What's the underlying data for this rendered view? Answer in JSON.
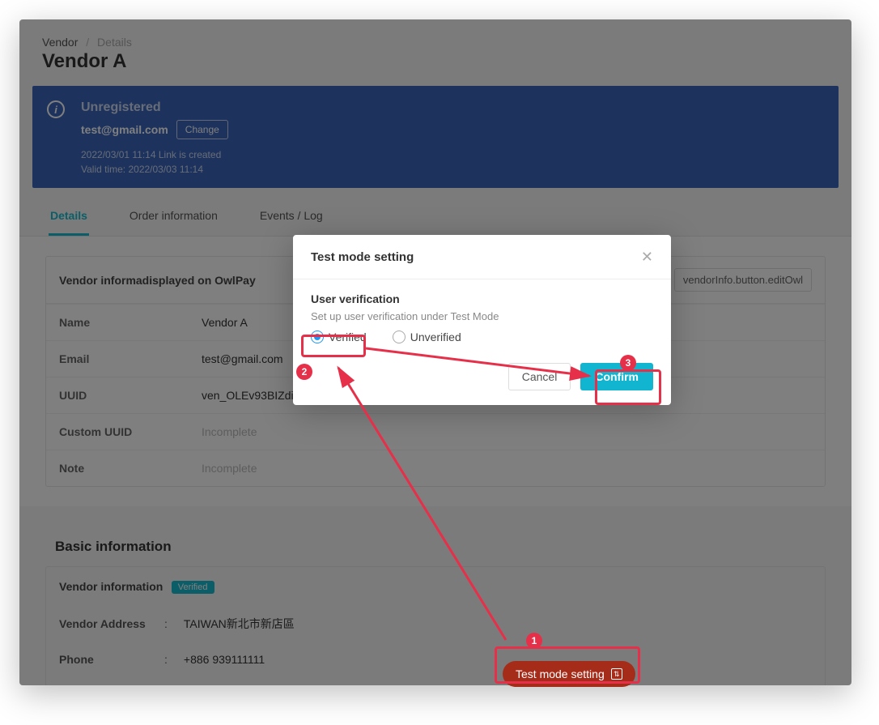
{
  "crumbs": {
    "root": "Vendor",
    "current": "Details"
  },
  "page_title": "Vendor A",
  "banner": {
    "status": "Unregistered",
    "email": "test@gmail.com",
    "change_label": "Change",
    "meta1": "2022/03/01 11:14 Link is created",
    "meta2": "Valid time: 2022/03/03 11:14"
  },
  "tabs": {
    "details": "Details",
    "order_info": "Order information",
    "events": "Events / Log"
  },
  "vendor_card": {
    "header": "Vendor informadisplayed on OwlPay",
    "edit_label": "vendorInfo.button.editOwl",
    "name_k": "Name",
    "name_v": "Vendor A",
    "email_k": "Email",
    "email_v": "test@gmail.com",
    "uuid_k": "UUID",
    "uuid_v": "ven_OLEv93BIZdiT",
    "cuuid_k": "Custom UUID",
    "cuuid_v": "Incomplete",
    "note_k": "Note",
    "note_v": "Incomplete"
  },
  "basic": {
    "section_title": "Basic information",
    "header": "Vendor information",
    "badge": "Verified",
    "addr_k": "Vendor Address",
    "addr_v": "TAIWAN新北市新店區",
    "phone_k": "Phone",
    "phone_v": "+886  939111111"
  },
  "float_btn": "Test mode setting",
  "modal": {
    "title": "Test mode setting",
    "section": "User verification",
    "sub": "Set up user verification under Test Mode",
    "opt_verified": "Verified",
    "opt_unverified": "Unverified",
    "cancel": "Cancel",
    "confirm": "Confirm"
  },
  "annotations": {
    "n1": "1",
    "n2": "2",
    "n3": "3"
  }
}
